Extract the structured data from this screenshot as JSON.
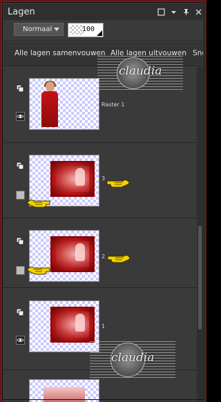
{
  "panel": {
    "title": "Lagen",
    "title_icons": [
      "window-restore-icon",
      "dropdown-arrow-icon",
      "pin-icon",
      "close-icon"
    ]
  },
  "blend": {
    "mode": "Normaal",
    "opacity": "100"
  },
  "commands": {
    "collapse_all": "Alle lagen samenvouwen",
    "expand_all": "Alle lagen uitvouwen",
    "next_cut": "Sne"
  },
  "layers": [
    {
      "name": "Raster 1",
      "visibility_icon": "eye-icon",
      "type_icon": "layer-stack-icon",
      "pointer": false
    },
    {
      "name": "3",
      "visibility_icon": "hidden-box-icon",
      "type_icon": "layer-stack-icon",
      "pointer": true
    },
    {
      "name": "2",
      "visibility_icon": "hidden-box-icon",
      "type_icon": "layer-stack-icon",
      "pointer": true
    },
    {
      "name": "1",
      "visibility_icon": "eye-icon",
      "type_icon": "layer-stack-icon",
      "pointer": false
    }
  ],
  "watermark": "claudia",
  "colors": {
    "frame": "#6b1414",
    "panel": "#3a3a3a",
    "pointer": "#f6d100"
  }
}
